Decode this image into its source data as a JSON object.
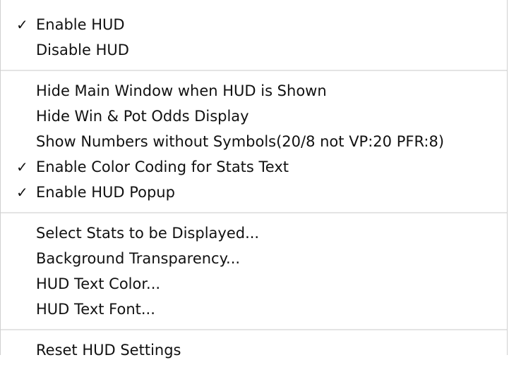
{
  "menu": {
    "sections": [
      {
        "items": [
          {
            "label": "Enable HUD",
            "checked": true
          },
          {
            "label": "Disable HUD",
            "checked": false
          }
        ]
      },
      {
        "items": [
          {
            "label": "Hide Main Window when HUD is Shown",
            "checked": false
          },
          {
            "label": "Hide Win & Pot Odds Display",
            "checked": false
          },
          {
            "label": "Show Numbers without Symbols(20/8 not VP:20 PFR:8)",
            "checked": false
          },
          {
            "label": "Enable Color Coding for Stats Text",
            "checked": true
          },
          {
            "label": "Enable HUD Popup",
            "checked": true
          }
        ]
      },
      {
        "items": [
          {
            "label": "Select Stats to be Displayed...",
            "checked": false
          },
          {
            "label": "Background Transparency...",
            "checked": false
          },
          {
            "label": "HUD Text Color...",
            "checked": false
          },
          {
            "label": "HUD Text Font...",
            "checked": false
          }
        ]
      },
      {
        "items": [
          {
            "label": "Reset HUD Settings",
            "checked": false
          }
        ]
      }
    ],
    "checkmark_glyph": "✓"
  }
}
